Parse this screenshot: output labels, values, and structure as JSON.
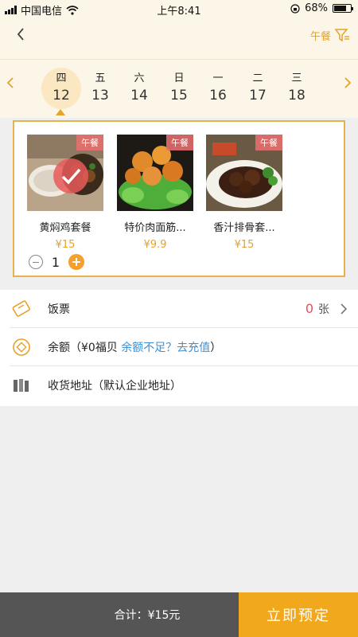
{
  "status": {
    "carrier": "中国电信",
    "time": "上午8:41",
    "battery": "68%"
  },
  "nav": {
    "back_icon": "chevron-left-icon",
    "meal_label": "午餐",
    "filter_icon": "filter-icon"
  },
  "dates": [
    {
      "weekday": "四",
      "date": "12",
      "selected": true
    },
    {
      "weekday": "五",
      "date": "13"
    },
    {
      "weekday": "六",
      "date": "14"
    },
    {
      "weekday": "日",
      "date": "15"
    },
    {
      "weekday": "一",
      "date": "16"
    },
    {
      "weekday": "二",
      "date": "17"
    },
    {
      "weekday": "三",
      "date": "18"
    }
  ],
  "dishes": [
    {
      "name": "黄焖鸡套餐",
      "price": "¥15",
      "tag": "午餐",
      "selected": true
    },
    {
      "name": "特价肉面筋...",
      "price": "¥9.9",
      "tag": "午餐"
    },
    {
      "name": "香汁排骨套...",
      "price": "¥15",
      "tag": "午餐"
    }
  ],
  "stepper": {
    "quantity": "1"
  },
  "info": {
    "ticket_label": "饭票",
    "ticket_count": "0",
    "ticket_unit": "张",
    "balance_label": "余额（¥0福贝",
    "balance_link": "余额不足？去充值",
    "balance_close": "）",
    "address_label": "收货地址（默认企业地址）"
  },
  "bottom": {
    "total": "合计：¥15元",
    "order_button": "立即预定"
  },
  "colors": {
    "accent": "#f2a81c",
    "header_bg": "#fbf6e7",
    "tag_red": "#e76e6e",
    "link": "#3d8fd0"
  }
}
